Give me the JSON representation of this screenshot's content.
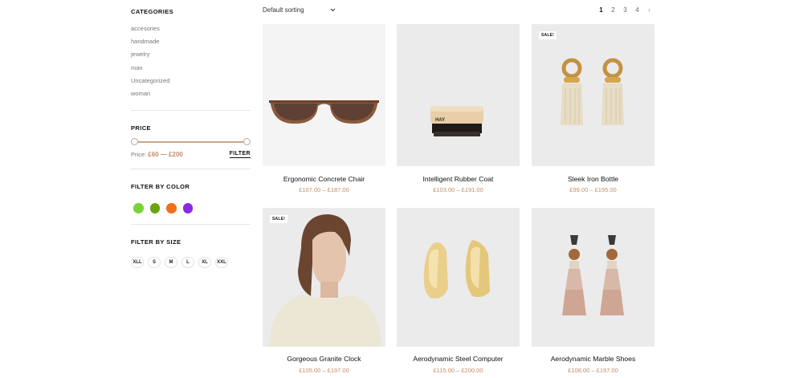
{
  "sidebar": {
    "categories_title": "CATEGORIES",
    "categories": [
      "accesories",
      "handmade",
      "jewelry",
      "man",
      "Uncategorized",
      "woman"
    ],
    "price_title": "PRICE",
    "price_label": "Price:",
    "price_range": "£60 — £200",
    "filter_label": "FILTER",
    "color_title": "FILTER BY COLOR",
    "colors": [
      "#79d23a",
      "#6aa511",
      "#f0701d",
      "#8a2be2"
    ],
    "size_title": "FILTER BY SIZE",
    "sizes": [
      "XLL",
      "S",
      "M",
      "L",
      "XL",
      "XXL"
    ]
  },
  "toolbar": {
    "sorting": "Default sorting",
    "pages": [
      "1",
      "2",
      "3",
      "4"
    ],
    "current_page": "1",
    "next": "›"
  },
  "products": [
    {
      "name": "Ergonomic Concrete Chair",
      "price": "£107.00 – £187.00",
      "sale": "",
      "image": "sunglasses"
    },
    {
      "name": "Intelligent Rubber Coat",
      "price": "£103.00 – £191.00",
      "sale": "",
      "image": "brush"
    },
    {
      "name": "Sleek Iron Bottle",
      "price": "£99.00 – £195.00",
      "sale": "SALE!",
      "image": "tassel-earrings"
    },
    {
      "name": "Gorgeous Granite Clock",
      "price": "£105.00 – £197.00",
      "sale": "SALE!",
      "image": "woman-portrait"
    },
    {
      "name": "Aerodynamic Steel Computer",
      "price": "£115.00 – £200.00",
      "sale": "",
      "image": "gold-earrings"
    },
    {
      "name": "Aerodynamic Marble Shoes",
      "price": "£108.00 – £197.00",
      "sale": "",
      "image": "beaded-tassel-earrings"
    }
  ],
  "brush_text": "HAY"
}
